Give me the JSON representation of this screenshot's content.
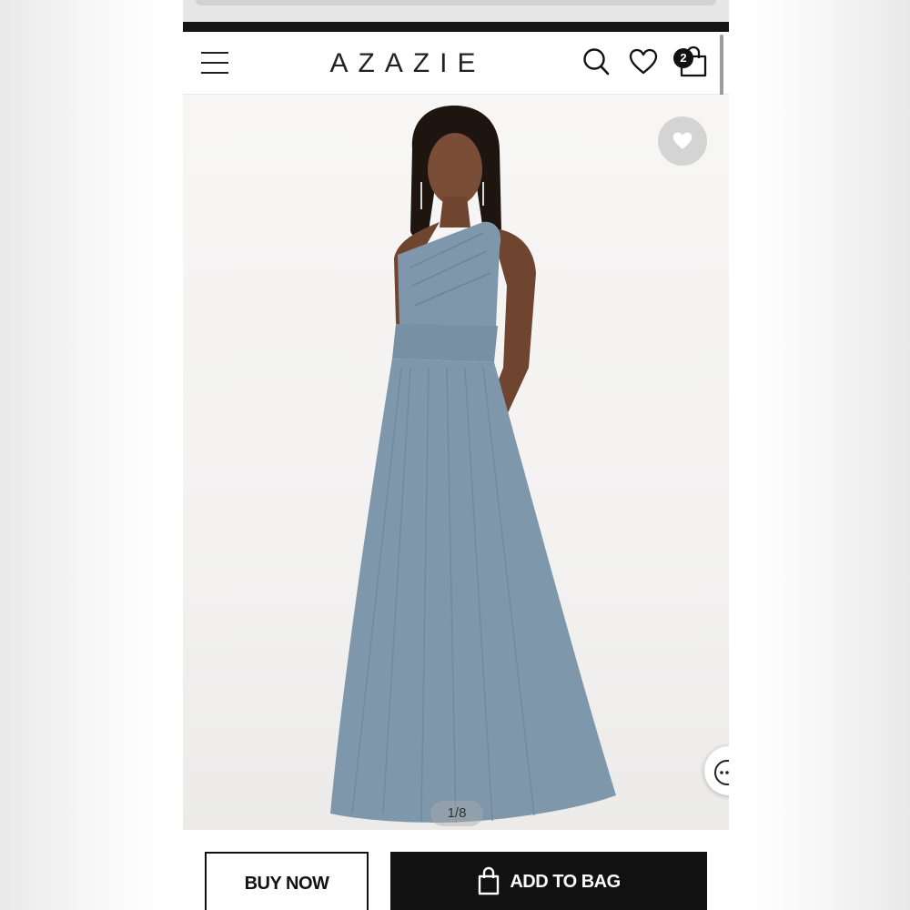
{
  "header": {
    "logo": "AZAZIE",
    "bag_count": "2",
    "icons": [
      "menu-icon",
      "search-icon",
      "heart-icon",
      "shopping-bag-icon"
    ]
  },
  "gallery": {
    "counter": "1/8",
    "dress_color": "#7f97ab",
    "favorite_icon": "heart-icon"
  },
  "actions": {
    "buy_now_label": "BUY NOW",
    "add_to_bag_label": "ADD TO BAG"
  },
  "colors": {
    "primary": "#111111",
    "background": "#ffffff"
  }
}
